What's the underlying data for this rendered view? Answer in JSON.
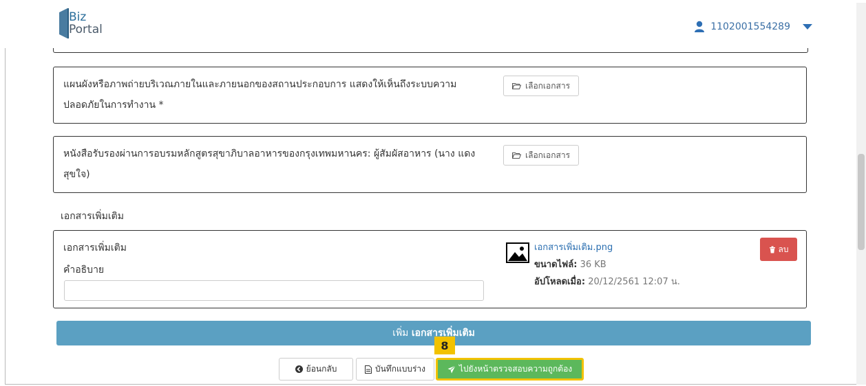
{
  "header": {
    "logo_line1": "Biz",
    "logo_line2": "Portal",
    "user_id": "1102001554289"
  },
  "documents": [
    {
      "text": "แผนผังหรือภาพถ่ายบริเวณภายในและภายนอกของสถานประกอบการ แสดงให้เห็นถึงระบบความปลอดภัยในการทำงาน *",
      "button_label": "เลือกเอกสาร"
    },
    {
      "text": "หนังสือรับรองผ่านการอบรมหลักสูตรสุขาภิบาลอาหารของกรุงเทพมหานคร: ผู้สัมผัสอาหาร (นาง แดง สุขใจ)",
      "button_label": "เลือกเอกสาร"
    }
  ],
  "extra_section": {
    "title": "เอกสารเพิ่มเติม",
    "card_title": "เอกสารเพิ่มเติม",
    "desc_label": "คำอธิบาย",
    "desc_value": "",
    "file_name": "เอกสารเพิ่มเติม.png",
    "size_label": "ขนาดไฟล์:",
    "size_value": "36 KB",
    "uploaded_label": "อัปโหลดเมื่อ:",
    "uploaded_value": "20/12/2561 12:07 น.",
    "delete_label": "ลบ"
  },
  "add_bar": {
    "prefix": "เพิ่ม",
    "bold": "เอกสารเพิ่มเติม"
  },
  "badge": "8",
  "actions": {
    "back": "ย้อนกลับ",
    "save_draft": "บันทึกแบบร่าง",
    "next": "ไปยังหน้าตรวจสอบความถูกต้อง"
  },
  "colors": {
    "add_bar": "#5ba0c2",
    "delete": "#d9534f",
    "next": "#5cb85c",
    "highlight": "#f2c200"
  }
}
